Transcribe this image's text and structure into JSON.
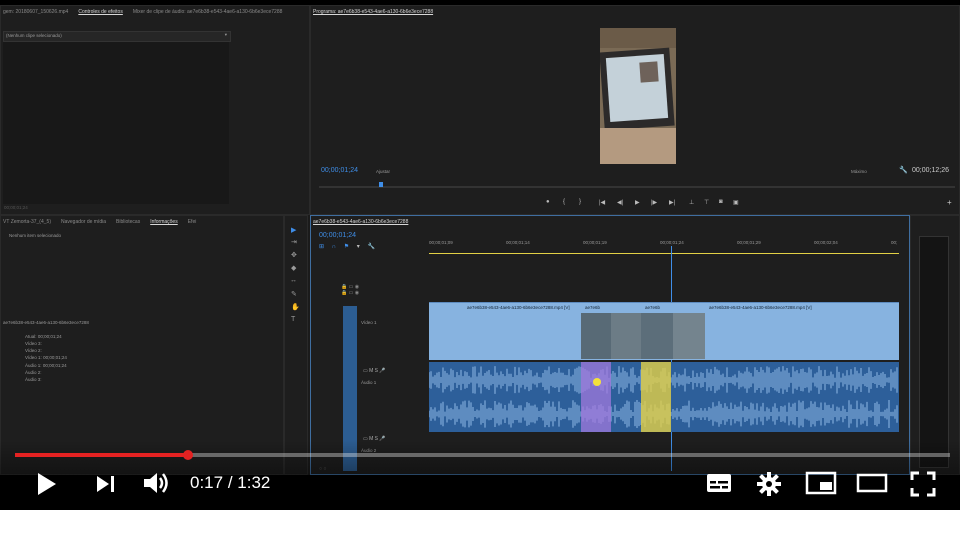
{
  "source_panel": {
    "tabs": [
      "gem: 20180607_150626.mp4",
      "Controles de efeitos",
      "Mixer de clipe de áudio: ae7e6b38-e543-4ae6-a130-6b6e3ece7288"
    ],
    "dropdown": "(Nenhum clipe selecionado)",
    "timecode": "00;00;01;24"
  },
  "info_panel": {
    "tabs": [
      "VT Zemorta-37_(4_5)",
      "Navegador de mídia",
      "Bibliotecas",
      "Informações",
      "Efei"
    ],
    "no_selection": "Nenhum item selecionado",
    "sequence_name": "ae7e6b38-e543-4ae6-a130-6b6e3ece7288",
    "rows": [
      {
        "label": "Atual:",
        "value": "00;00;01;24"
      },
      {
        "label": "Vídeo 3:",
        "value": ""
      },
      {
        "label": "Vídeo 2:",
        "value": ""
      },
      {
        "label": "Vídeo 1:",
        "value": "00;00;01;24"
      },
      {
        "label": "Áudio 1:",
        "value": "00;00;01;24"
      },
      {
        "label": "Áudio 2:",
        "value": ""
      },
      {
        "label": "Áudio 3:",
        "value": ""
      }
    ]
  },
  "program_monitor": {
    "title": "Programa: ae7e6b38-e543-4ae6-a130-6b6e3ece7288",
    "timecode": "00;00;01;24",
    "fit": "Ajustar",
    "quality": "Máximo",
    "duration": "00;00;12;26",
    "playhead_fraction": 0.094
  },
  "timeline": {
    "title": "ae7e6b38-e543-4ae6-a130-6b6e3ece7288",
    "timecode": "00;00;01;24",
    "ruler": [
      "00;00;01;09",
      "00;00;01;14",
      "00;00;01;19",
      "00;00;01;24",
      "00;00;01;29",
      "00;00;02;04",
      "00;"
    ],
    "tracks": {
      "video1": "Vídeo 1",
      "audio1": "Áudio 1",
      "audio2": "Áudio 2"
    },
    "clips": {
      "main_left": "ae7e6b38-e543-4ae6-a130-6b6e3ece7288.mp4 [V]",
      "small1": "ae7e6b",
      "small2": "ae7e6b",
      "main_right": "ae7e6b38-e543-4ae6-a130-6b6e3ece7288.mp4 [V]"
    },
    "colors": {
      "video": "#87b3e0",
      "audio": "#2d5f9a",
      "purple": "#9b7dd4",
      "yellow": "#e2d045",
      "accent": "#3f8ee8"
    }
  },
  "player": {
    "current_time": "0:17",
    "separator": " / ",
    "total_time": "1:32",
    "progress_fraction": 0.185,
    "progress_color": "#e52222"
  }
}
